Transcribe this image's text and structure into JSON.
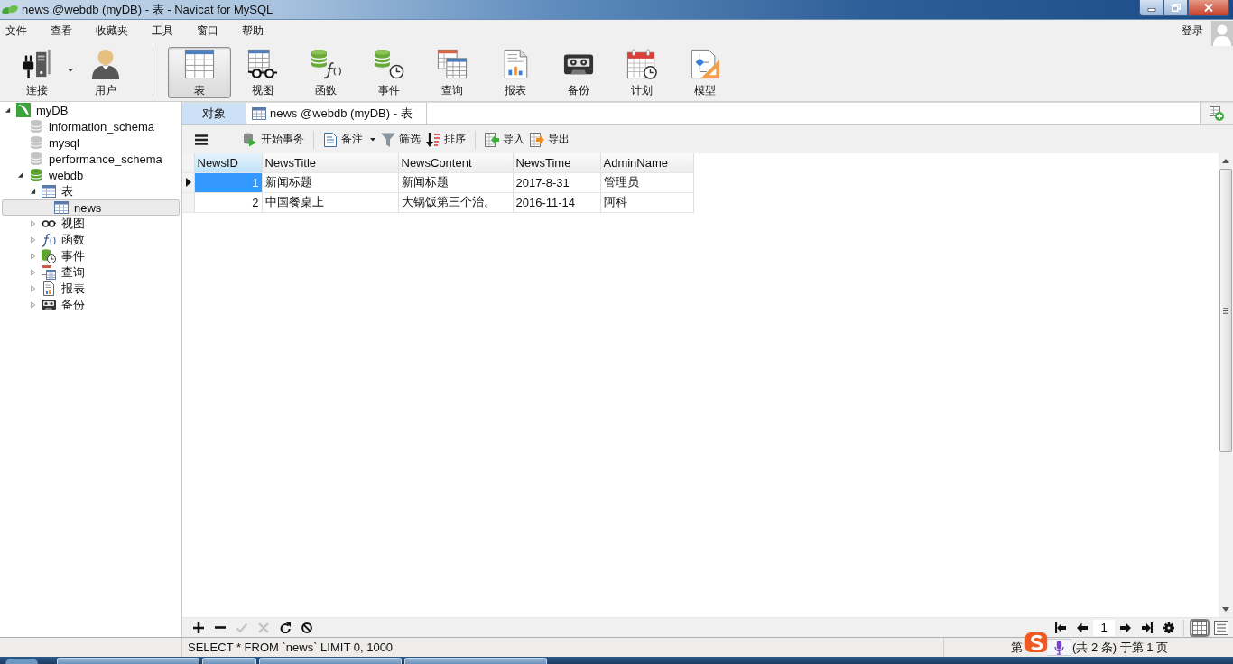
{
  "window": {
    "title": "news @webdb (myDB) - 表 - Navicat for MySQL"
  },
  "menu": [
    "文件",
    "查看",
    "收藏夹",
    "工具",
    "窗口",
    "帮助"
  ],
  "account": {
    "login": "登录"
  },
  "toolbar": {
    "groups": [
      {
        "buttons": [
          {
            "label": "连接",
            "kind": "connection",
            "selected": false,
            "dropdown": true
          },
          {
            "label": "用户",
            "kind": "user",
            "selected": false,
            "dropdown": false
          }
        ]
      },
      {
        "buttons": [
          {
            "label": "表",
            "kind": "table",
            "selected": true,
            "dropdown": false
          },
          {
            "label": "视图",
            "kind": "view",
            "selected": false,
            "dropdown": false
          },
          {
            "label": "函数",
            "kind": "function",
            "selected": false,
            "dropdown": false
          },
          {
            "label": "事件",
            "kind": "event",
            "selected": false,
            "dropdown": false
          },
          {
            "label": "查询",
            "kind": "query",
            "selected": false,
            "dropdown": false
          },
          {
            "label": "报表",
            "kind": "report",
            "selected": false,
            "dropdown": false
          },
          {
            "label": "备份",
            "kind": "backup",
            "selected": false,
            "dropdown": false
          },
          {
            "label": "计划",
            "kind": "schedule",
            "selected": false,
            "dropdown": false
          },
          {
            "label": "模型",
            "kind": "model",
            "selected": false,
            "dropdown": false
          }
        ]
      }
    ]
  },
  "tree": [
    {
      "label": "myDB",
      "kind": "connection",
      "expanded": true,
      "selected": false,
      "children": [
        {
          "label": "information_schema",
          "kind": "database",
          "open": false,
          "selected": false
        },
        {
          "label": "mysql",
          "kind": "database",
          "open": false,
          "selected": false
        },
        {
          "label": "performance_schema",
          "kind": "database",
          "open": false,
          "selected": false
        },
        {
          "label": "webdb",
          "kind": "database",
          "open": true,
          "expanded": true,
          "selected": false,
          "children": [
            {
              "label": "表",
              "kind": "tables",
              "expanded": true,
              "selected": false,
              "children": [
                {
                  "label": "news",
                  "kind": "table",
                  "selected": true
                }
              ]
            },
            {
              "label": "视图",
              "kind": "views",
              "expanded": false,
              "selected": false
            },
            {
              "label": "函数",
              "kind": "functions",
              "expanded": false,
              "selected": false
            },
            {
              "label": "事件",
              "kind": "events",
              "expanded": false,
              "selected": false
            },
            {
              "label": "查询",
              "kind": "queries",
              "expanded": false,
              "selected": false
            },
            {
              "label": "报表",
              "kind": "reports",
              "expanded": false,
              "selected": false
            },
            {
              "label": "备份",
              "kind": "backups",
              "expanded": false,
              "selected": false
            }
          ]
        }
      ]
    }
  ],
  "tabs": [
    {
      "label": "对象",
      "kind": "objects",
      "selected": false
    },
    {
      "label": "news @webdb (myDB) - 表",
      "kind": "table",
      "selected": true
    }
  ],
  "object_toolbar": {
    "groups": [
      {
        "buttons": [
          {
            "label": "开始事务",
            "kind": "transaction",
            "dropdown": false
          }
        ]
      },
      {
        "buttons": [
          {
            "label": "备注",
            "kind": "note",
            "dropdown": true
          },
          {
            "label": "筛选",
            "kind": "filter",
            "dropdown": false
          },
          {
            "label": "排序",
            "kind": "sort",
            "dropdown": false
          }
        ]
      },
      {
        "buttons": [
          {
            "label": "导入",
            "kind": "import",
            "dropdown": false
          },
          {
            "label": "导出",
            "kind": "export",
            "dropdown": false
          }
        ]
      }
    ]
  },
  "grid": {
    "columns": [
      {
        "label": "NewsID",
        "kind": "number",
        "selected": true
      },
      {
        "label": "NewsTitle",
        "kind": "text",
        "selected": false
      },
      {
        "label": "NewsContent",
        "kind": "text",
        "selected": false
      },
      {
        "label": "NewsTime",
        "kind": "text",
        "selected": false
      },
      {
        "label": "AdminName",
        "kind": "text",
        "selected": false
      }
    ],
    "rows": [
      {
        "current": true,
        "cells": [
          {
            "text": "1",
            "selected": true
          },
          {
            "text": "新闻标题",
            "selected": false
          },
          {
            "text": "新闻标题",
            "selected": false
          },
          {
            "text": "2017-8-31",
            "selected": false
          },
          {
            "text": "管理员",
            "selected": false
          }
        ]
      },
      {
        "current": false,
        "cells": [
          {
            "text": "2",
            "selected": false
          },
          {
            "text": "中国餐桌上",
            "selected": false
          },
          {
            "text": "大锅饭第三个治。",
            "selected": false
          },
          {
            "text": "2016-11-14",
            "selected": false
          },
          {
            "text": "阿科",
            "selected": false
          }
        ]
      }
    ]
  },
  "record_actions": [
    {
      "kind": "add",
      "disabled": false
    },
    {
      "kind": "delete",
      "disabled": false
    },
    {
      "kind": "apply",
      "disabled": true
    },
    {
      "kind": "cancel",
      "disabled": true
    },
    {
      "kind": "refresh",
      "disabled": false
    },
    {
      "kind": "stop",
      "disabled": false
    }
  ],
  "pagination": {
    "page": "1"
  },
  "view_modes": [
    {
      "kind": "grid",
      "selected": true
    },
    {
      "kind": "form",
      "selected": false
    }
  ],
  "status_bar": {
    "query": "SELECT * FROM `news` LIMIT 0, 1000",
    "record_prefix": "第",
    "record_summary": "(共 2 条) 于第 1 页"
  }
}
